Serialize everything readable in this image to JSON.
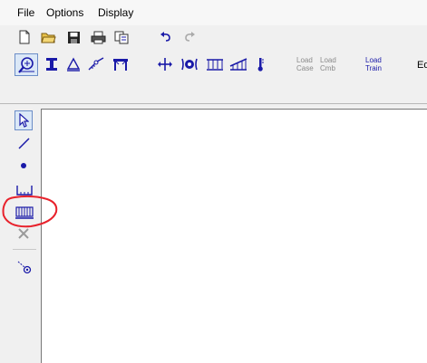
{
  "menu": {
    "file": "File",
    "options": "Options",
    "display": "Display"
  },
  "toolbar_file": {
    "icons": [
      "new-document-icon",
      "open-folder-icon",
      "save-icon",
      "print-icon",
      "copy-icon",
      "undo-icon",
      "redo-icon"
    ]
  },
  "toolbar_model": {
    "load_case": [
      "Load",
      "Case"
    ],
    "load_comb": [
      "Load",
      "Cmb"
    ],
    "load_train": [
      "Load",
      "Train"
    ],
    "edit_partial": "Ed"
  },
  "colors": {
    "accent": "#1a1aa8",
    "annotation": "#e8222c",
    "selected_bg": "#dbe8f7",
    "selected_border": "#6b8dc7"
  }
}
